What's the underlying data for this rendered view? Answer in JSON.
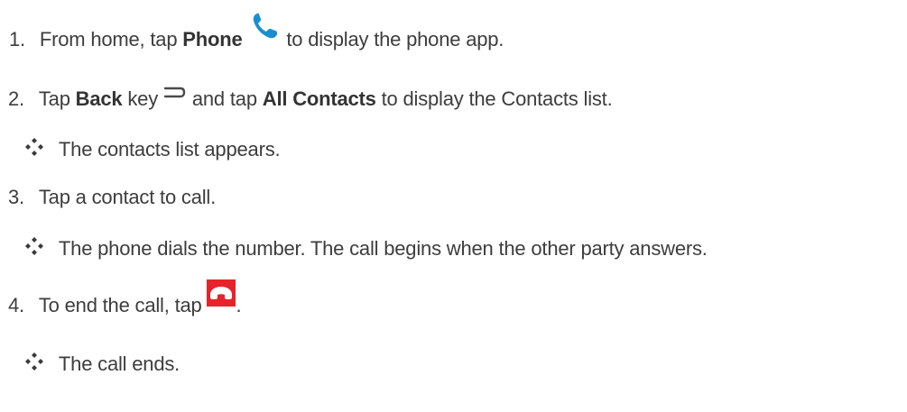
{
  "steps": [
    {
      "number": "1.",
      "text_before": "From home, tap ",
      "bold": "Phone",
      "icon": "phone-icon",
      "text_after": " to display the phone app."
    },
    {
      "number": "2.",
      "text_before": "Tap ",
      "bold1": "Back",
      "text_mid1": " key ",
      "icon": "back-key-icon",
      "text_mid2": " and tap ",
      "bold2": "All Contacts",
      "text_after": " to display the Contacts list.",
      "result": "The contacts list appears."
    },
    {
      "number": "3.",
      "text": "Tap a contact to call.",
      "result": "The phone dials the number. The call begins when the other party answers."
    },
    {
      "number": "4.",
      "text_before": "To end the call, tap ",
      "icon": "end-call-icon",
      "text_after": ".",
      "result": "The call ends."
    }
  ],
  "colors": {
    "phone_icon": "#1a8fd0",
    "end_call_bg": "#e8222a",
    "bullet": "#3a3a3a",
    "text": "#3d3d3d"
  }
}
